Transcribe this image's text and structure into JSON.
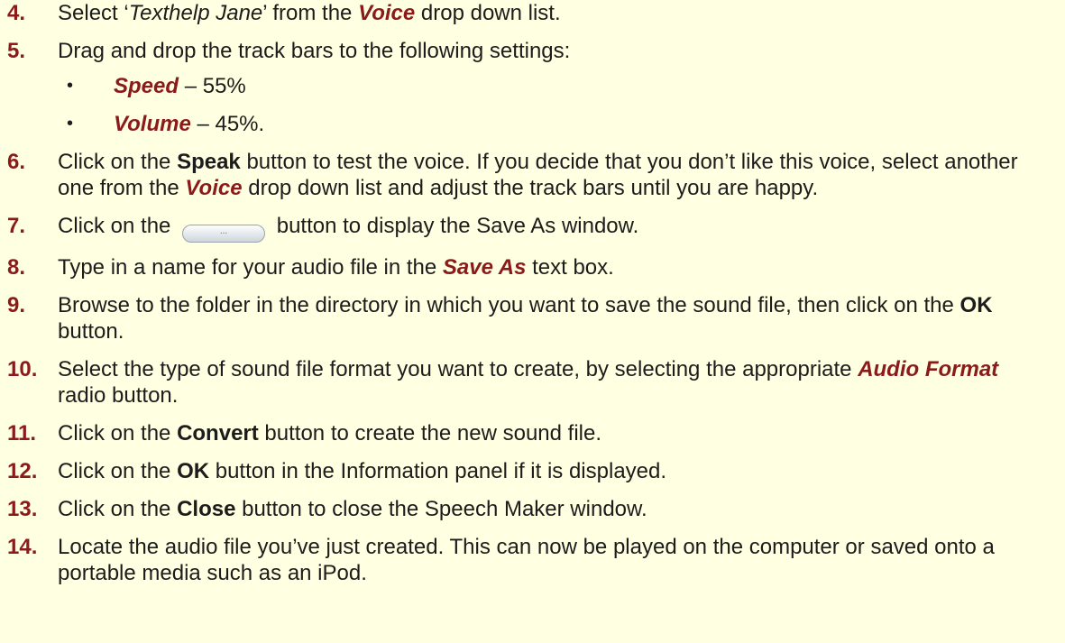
{
  "steps": [
    {
      "num": "4.",
      "parts": [
        {
          "t": "Select ‘",
          "s": ""
        },
        {
          "t": "Texthelp Jane",
          "s": "it"
        },
        {
          "t": "’ from the ",
          "s": ""
        },
        {
          "t": "Voice",
          "s": "bi"
        },
        {
          "t": " drop down list.",
          "s": ""
        }
      ]
    },
    {
      "num": "5.",
      "parts": [
        {
          "t": "Drag and drop the track bars to the following settings:",
          "s": ""
        }
      ],
      "bullets": [
        [
          {
            "t": "Speed",
            "s": "bi"
          },
          {
            "t": " – 55%",
            "s": ""
          }
        ],
        [
          {
            "t": "Volume",
            "s": "bi"
          },
          {
            "t": " – 45%.",
            "s": ""
          }
        ]
      ]
    },
    {
      "num": "6.",
      "parts": [
        {
          "t": "Click on the ",
          "s": ""
        },
        {
          "t": "Speak",
          "s": "b"
        },
        {
          "t": " button to test the voice. If you decide that you don’t like this voice, select another one from the ",
          "s": ""
        },
        {
          "t": "Voice",
          "s": "bi"
        },
        {
          "t": " drop down list and adjust the track bars until you are happy.",
          "s": ""
        }
      ]
    },
    {
      "num": "7.",
      "parts": [
        {
          "t": "Click on the ",
          "s": ""
        },
        {
          "t": "...",
          "s": "btn"
        },
        {
          "t": " button to display the Save As window.",
          "s": ""
        }
      ]
    },
    {
      "num": "8.",
      "parts": [
        {
          "t": "Type in a name for your audio file in the ",
          "s": ""
        },
        {
          "t": "Save As",
          "s": "bi"
        },
        {
          "t": " text box.",
          "s": ""
        }
      ]
    },
    {
      "num": "9.",
      "parts": [
        {
          "t": "Browse to the folder in the directory in which you want to save the sound file, then click on the ",
          "s": ""
        },
        {
          "t": "OK",
          "s": "b"
        },
        {
          "t": " button.",
          "s": ""
        }
      ]
    },
    {
      "num": "10.",
      "parts": [
        {
          "t": "Select the type of sound file format you want to create, by selecting the appropriate ",
          "s": ""
        },
        {
          "t": "Audio Format",
          "s": "bi"
        },
        {
          "t": " radio button.",
          "s": ""
        }
      ]
    },
    {
      "num": "11.",
      "parts": [
        {
          "t": "Click on the ",
          "s": ""
        },
        {
          "t": "Convert",
          "s": "b"
        },
        {
          "t": " button to create the new sound file.",
          "s": ""
        }
      ]
    },
    {
      "num": "12.",
      "parts": [
        {
          "t": "Click on the ",
          "s": ""
        },
        {
          "t": "OK",
          "s": "b"
        },
        {
          "t": " button in the Information panel if it is displayed.",
          "s": ""
        }
      ]
    },
    {
      "num": "13.",
      "parts": [
        {
          "t": "Click on the ",
          "s": ""
        },
        {
          "t": "Close",
          "s": "b"
        },
        {
          "t": " button to close the Speech Maker window.",
          "s": ""
        }
      ]
    },
    {
      "num": "14.",
      "parts": [
        {
          "t": "Locate the audio file you’ve just created. This can now be played on the computer or saved onto a portable media such as an iPod.",
          "s": ""
        }
      ]
    }
  ],
  "colors": {
    "background": "#FFFFE1",
    "accent": "#8B1A1A",
    "text": "#1c1c1c"
  }
}
